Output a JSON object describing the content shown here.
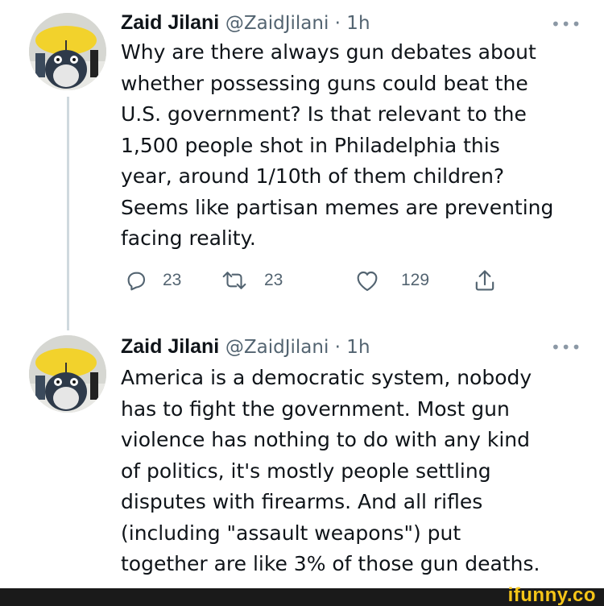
{
  "tweets": [
    {
      "author": "Zaid Jilani",
      "handle_time": "@ZaidJilani · 1h",
      "text_lines": [
        "Why are there always gun debates about",
        "whether possessing guns could beat the",
        "U.S. government? Is that relevant to the",
        "1,500 people shot in Philadelphia this",
        "year, around 1/10th of them children?",
        "Seems like partisan memes are preventing",
        "facing reality."
      ],
      "actions": {
        "reply_count": "23",
        "retweet_count": "23",
        "like_count": "129"
      }
    },
    {
      "author": "Zaid Jilani",
      "handle_time": "@ZaidJilani · 1h",
      "text_lines": [
        "America is a democratic system, nobody",
        "has to fight the government. Most gun",
        "violence has nothing to do with any kind",
        "of politics, it's mostly people settling",
        "disputes with firearms. And all rifles",
        "(including \"assault weapons\") put",
        "together are like 3% of those gun deaths."
      ]
    }
  ],
  "more_icon": "•••",
  "watermark": "ifunny.co",
  "colors": {
    "text": "#0f1419",
    "secondary": "#536471",
    "line": "#cfd9de",
    "watermark": "#f5c518"
  }
}
